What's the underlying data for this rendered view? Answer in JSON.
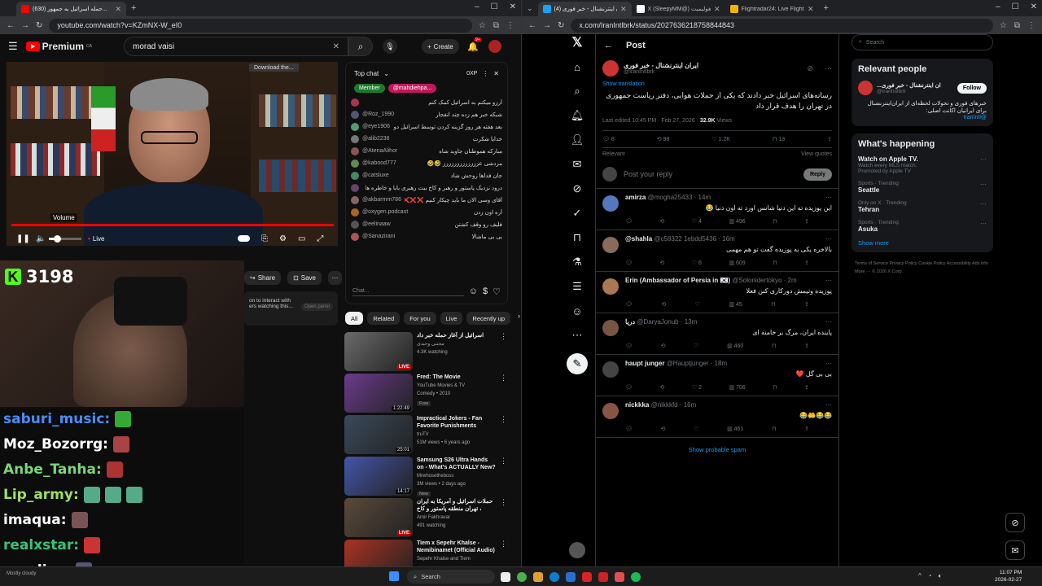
{
  "left_browser": {
    "tabs": [
      {
        "title": "(630) حمله اسرائیل به جمهور..."
      }
    ],
    "url": "youtube.com/watch?v=KZmNX-W_eI0"
  },
  "youtube": {
    "logo": "Premium",
    "logo_region": "CA",
    "search_query": "morad vaisi",
    "create_label": "Create",
    "notif_count": "9+",
    "download_notice": "Download the...",
    "volume_label": "Volume",
    "live_label": "Live",
    "video_title_partial": "حمله اسرائیل به جمهوری اسلامی",
    "share_label": "Share",
    "save_label": "Save",
    "interact_note_1": "on to interact with",
    "interact_note_2": "ers watching this...",
    "open_panel": "Open panel",
    "chat": {
      "title": "Top chat",
      "xp": "0XP",
      "member_label": "Member",
      "member_user": "@mahdiehpa...",
      "input_placeholder": "Chat...",
      "messages": [
        {
          "user": "",
          "text": "آرزو میکنم به اسرائیل کمک کنم",
          "color": "#a35"
        },
        {
          "user": "@Roz_1990",
          "text": "شبکه خبر هم زده چند انفجار",
          "color": "#557"
        },
        {
          "user": "@eye1906",
          "text": "بعد هفته هر روز گزینه کردن توسط اسرائیل دوباره خیلی خوشحالم",
          "color": "#597"
        },
        {
          "user": "@alib2236",
          "text": "خدایا شکرت",
          "color": "#777"
        },
        {
          "user": "@AtenaAlihor",
          "text": "مبارکه هموطنان جاوید شاه",
          "color": "#855"
        },
        {
          "user": "@kabood777",
          "text": "مردشی عززززززززززززز 🤣🤣",
          "color": "#685"
        },
        {
          "user": "@catsluxe",
          "text": "جان فداها روحش شاد",
          "color": "#486"
        },
        {
          "user": "",
          "text": "درود نزدیک پاستور و رهبر و کاخ بیت رهبری بابا و خاطره ها",
          "color": "#646"
        },
        {
          "user": "@akbarmm786",
          "text": "آقای وسی الان ما باید چیکار کنیم ❌❌❌❌",
          "color": "#866"
        },
        {
          "user": "@oxygen.podcast",
          "text": "آره اون زدن",
          "color": "#a62"
        },
        {
          "user": "@eelinaaw",
          "text": "فلیف رو وقف کشتن",
          "color": "#555"
        },
        {
          "user": "@Sanazirani",
          "text": "بی بی ماشالا",
          "color": "#a55"
        }
      ]
    },
    "filters": [
      "All",
      "Related",
      "For you",
      "Live",
      "Recently up"
    ],
    "recommendations": [
      {
        "title": "اسرائیل از آغاز حمله خبر داد",
        "meta": "مجتبی وحیدی",
        "views": "4.3K watching",
        "badge": "LIVE",
        "color": "#6a6a6a"
      },
      {
        "title": "Fred: The Movie",
        "meta": "YouTube Movies & TV",
        "views": "Comedy • 2010",
        "badge": "1:22:49",
        "extra": "Free",
        "color": "#6b3b8c"
      },
      {
        "title": "Impractical Jokers - Fan Favorite Punishments (Mashu...",
        "meta": "truTV",
        "views": "51M views • 6 years ago",
        "badge": "25:01",
        "color": "#3a4a5a"
      },
      {
        "title": "Samsung S26 Ultra Hands on - What's ACTUALLY New?",
        "meta": "Mrwhosetheboss",
        "views": "3M views • 2 days ago",
        "badge": "14:17",
        "extra": "New",
        "color": "#4455aa"
      },
      {
        "title": "حملات اسرائیل و آمریکا به ایران ، تهران منطقه پاستور و کاخ خامنه ای را هدف...",
        "meta": "Amir Fakhravar",
        "views": "491 watching",
        "badge": "LIVE",
        "color": "#5a4a3a"
      },
      {
        "title": "Tiem x Sepehr Khalse - Nemibinamet (Official Audio)",
        "meta": "Sepehr Khalse and Tiem",
        "views": "",
        "badge": "",
        "color": "#aa3322"
      }
    ]
  },
  "stream_overlay": {
    "kick_count": "3198",
    "chat_lines": [
      {
        "name": "saburi_music:",
        "color": "#4a8cff"
      },
      {
        "name": "Moz_Bozorrg:",
        "color": "#ffffff"
      },
      {
        "name": "Anbe_Tanha:",
        "color": "#7bd67b"
      },
      {
        "name": "Lip_army:",
        "color": "#a0e060"
      },
      {
        "name": "imaqua:",
        "color": "#ffffff"
      },
      {
        "name": "realxstar:",
        "color": "#39c27a"
      },
      {
        "name": "goodiyy:",
        "color": "#ffffff"
      }
    ],
    "weather": "Mostly cloudy"
  },
  "right_browser": {
    "tabs": [
      {
        "title": "(4) ایران اینترنشنال - خبر فوری"
      },
      {
        "title": "X (SleepyMM@) مغولیمیت"
      },
      {
        "title": "Flightradar24: Live Flight Track..."
      }
    ],
    "url": "x.com/IranIntlbrk/status/2027636218758844843"
  },
  "x": {
    "header": "Post",
    "author": "ایران اینترنشنال - خبر فوری",
    "handle": "@IranIntlbrk",
    "show_translation": "Show translation",
    "post_text": "رسانه‌های اسرائیل خبر دادند که یکی از حملات هوایی، دفتر ریاست جمهوری در تهران را هدف قرار داد",
    "edited": "Last edited 10:45 PM · Feb 27, 2026 · ",
    "views_count": "32.9K",
    "views_label": "Views",
    "stats": {
      "replies": "8",
      "reposts": "98",
      "likes": "1.2K",
      "bookmarks": "13"
    },
    "relevant": "Relevant",
    "view_quotes": "View quotes",
    "reply_placeholder": "Post your reply",
    "reply_button": "Reply",
    "replies": [
      {
        "name": "amirza",
        "handle": "@mogha25433 · 14m",
        "text": "این پوزیده ته این دنیا شانس اورد ته اون دنیا 😂",
        "likes": "4",
        "views": "496",
        "color": "#5577bb"
      },
      {
        "name": "@shahla",
        "handle": "@c58322 1ebdd5436 · 16m",
        "text": "بالاخره یکی به پوزیده گفت تو هم مهمی",
        "likes": "6",
        "views": "609",
        "color": "#8a6a5a"
      },
      {
        "name": "Erin (Ambassador of Persia in 🇰🇷)",
        "handle": "@Solonidertokyo · 2m",
        "text": "پوزیده وتیمش دورکاری کنن فعلا",
        "likes": "",
        "views": "45",
        "color": "#aa7755"
      },
      {
        "name": "دریا",
        "handle": "@DaryaJonub · 13m",
        "text": "پاینده ایران، مرگ بر خامنه ای",
        "likes": "",
        "views": "460",
        "color": "#775544"
      },
      {
        "name": "haupt junger",
        "handle": "@Hauptjunger · 18m",
        "text": "بی بی گل ❤️",
        "likes": "2",
        "views": "706",
        "color": "#444"
      },
      {
        "name": "nickkka",
        "handle": "@nikkkfd · 16m",
        "text": "😂😂🤲😂",
        "likes": "",
        "views": "461",
        "color": "#885544"
      }
    ],
    "spam_link": "Show probable spam",
    "search_placeholder": "Search",
    "relevant_people": {
      "title": "Relevant people",
      "name": "...ان اینترنشنال - خبر فوری",
      "handle": "@IranIntlbrk",
      "follow": "Follow",
      "bio": "خبرهای فوری و تحولات لحظه‌ای از ایران‌اینترنشنال برای ایرانیان اکانت اصلی:",
      "bio_link": "@IranIntl"
    },
    "happening": {
      "title": "What's happening",
      "items": [
        {
          "category": "",
          "name": "Watch on Apple TV.",
          "sub": "Watch every MLS match.",
          "promo": "Promoted by Apple TV"
        },
        {
          "category": "Sports · Trending",
          "name": "Seattle",
          "sub": "",
          "promo": ""
        },
        {
          "category": "Only on X · Trending",
          "name": "Tehran",
          "sub": "",
          "promo": ""
        },
        {
          "category": "Sports · Trending",
          "name": "Asuka",
          "sub": "",
          "promo": ""
        }
      ],
      "show_more": "Show more"
    },
    "footer": "Terms of Service  Privacy Policy  Cookie Policy  Accessibility  Ads info  More ···  © 2026 X Corp."
  },
  "taskbar": {
    "search": "Search",
    "time": "11:07 PM",
    "date": "2026-02-27"
  }
}
